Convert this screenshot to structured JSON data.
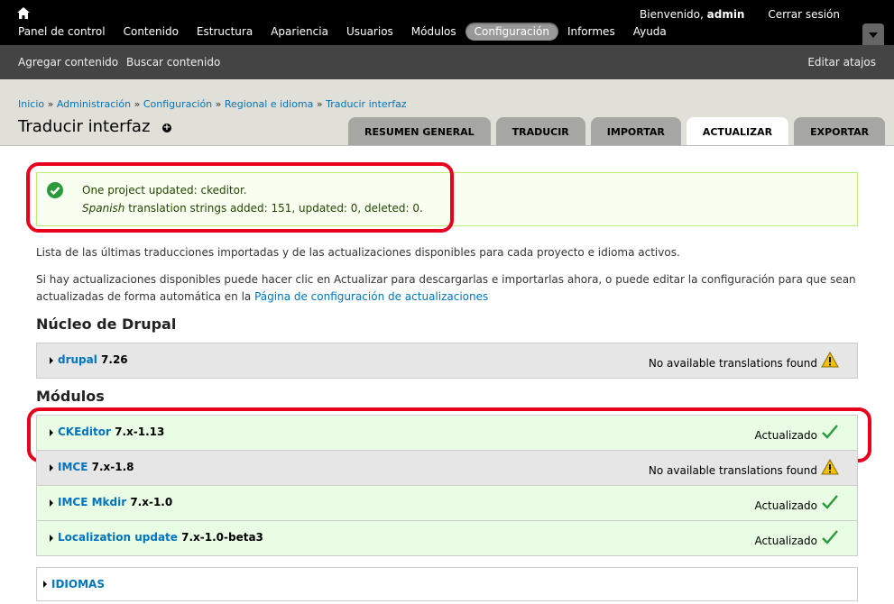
{
  "toolbar": {
    "welcome_prefix": "Bienvenido, ",
    "username": "admin",
    "logout": "Cerrar sesión",
    "menu": [
      "Panel de control",
      "Contenido",
      "Estructura",
      "Apariencia",
      "Usuarios",
      "Módulos",
      "Configuración",
      "Informes",
      "Ayuda"
    ],
    "active_menu": "Configuración"
  },
  "shortcuts": {
    "items": [
      "Agregar contenido",
      "Buscar contenido"
    ],
    "edit": "Editar atajos"
  },
  "breadcrumb": [
    "Inicio",
    "Administración",
    "Configuración",
    "Regional e idioma",
    "Traducir interfaz"
  ],
  "breadcrumb_sep": " » ",
  "page_title": "Traducir interfaz",
  "tabs": [
    "RESUMEN GENERAL",
    "TRADUCIR",
    "IMPORTAR",
    "ACTUALIZAR",
    "EXPORTAR"
  ],
  "active_tab": "ACTUALIZAR",
  "message": {
    "line1": "One project updated: ckeditor.",
    "line2_lang": "Spanish",
    "line2_rest": " translation strings added: 151, updated: 0, deleted: 0."
  },
  "intro": "Lista de las últimas traducciones importadas y de las actualizaciones disponibles para cada proyecto e idioma activos.",
  "intro2_text": "Si hay actualizaciones disponibles puede hacer clic en Actualizar para descargarlas e importarlas ahora, o puede editar la configuración para que sean actualizadas de forma automática en la ",
  "intro2_link": "Página de configuración de actualizaciones",
  "sections": {
    "core": "Núcleo de Drupal",
    "modules": "Módulos"
  },
  "core_rows": [
    {
      "name": "drupal",
      "version": "7.26",
      "status": "No available translations found",
      "state": "warning"
    }
  ],
  "module_rows": [
    {
      "name": "CKEditor",
      "version": "7.x-1.13",
      "status": "Actualizado",
      "state": "ok"
    },
    {
      "name": "IMCE",
      "version": "7.x-1.8",
      "status": "No available translations found",
      "state": "warning"
    },
    {
      "name": "IMCE Mkdir",
      "version": "7.x-1.0",
      "status": "Actualizado",
      "state": "ok"
    },
    {
      "name": "Localization update",
      "version": "7.x-1.0-beta3",
      "status": "Actualizado",
      "state": "ok"
    }
  ],
  "languages_label": "IDIOMAS",
  "colors": {
    "callout": "#e8001c",
    "link": "#0074bd",
    "ok": "#2a9a3a",
    "warning": "#e0b000"
  }
}
